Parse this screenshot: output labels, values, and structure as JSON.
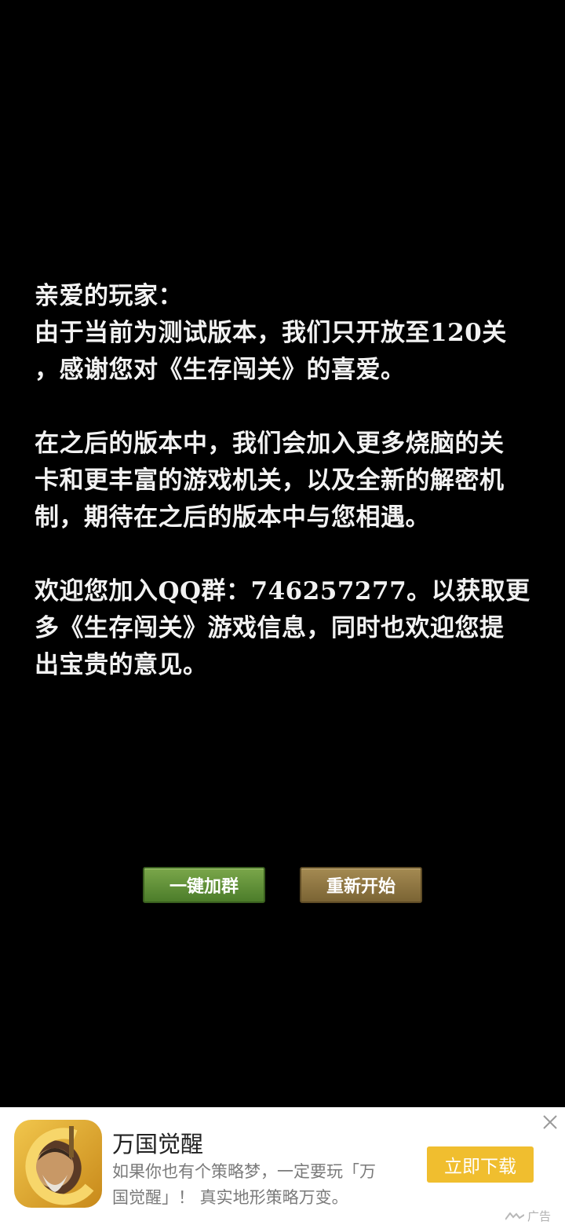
{
  "message": {
    "greeting": "亲爱的玩家：",
    "p1_line1": "由于当前为测试版本，我们只开放至120关",
    "p1_line2": "，感谢您对《生存闯关》的喜爱。",
    "p2_line1": "在之后的版本中，我们会加入更多烧脑的关",
    "p2_line2": "卡和更丰富的游戏机关，以及全新的解密机",
    "p2_line3": "制，期待在之后的版本中与您相遇。",
    "p3_line1": "欢迎您加入QQ群：746257277。以获取更",
    "p3_line2": "多《生存闯关》游戏信息，同时也欢迎您提",
    "p3_line3": "出宝贵的意见。"
  },
  "buttons": {
    "join_group": "一键加群",
    "restart": "重新开始"
  },
  "ad": {
    "icon": "game-app-icon",
    "title": "万国觉醒",
    "desc_line1": "如果你也有个策略梦，一定要玩「万",
    "desc_line2": "国觉醒」！ 真实地形策略万变。",
    "cta": "立即下载",
    "close_icon": "close-icon",
    "ad_label": "广告"
  },
  "colors": {
    "background": "#000000",
    "text": "#f2f2f2",
    "join_button": "#5e8f35",
    "restart_button": "#8f7742",
    "ad_cta": "#f0be2f"
  }
}
